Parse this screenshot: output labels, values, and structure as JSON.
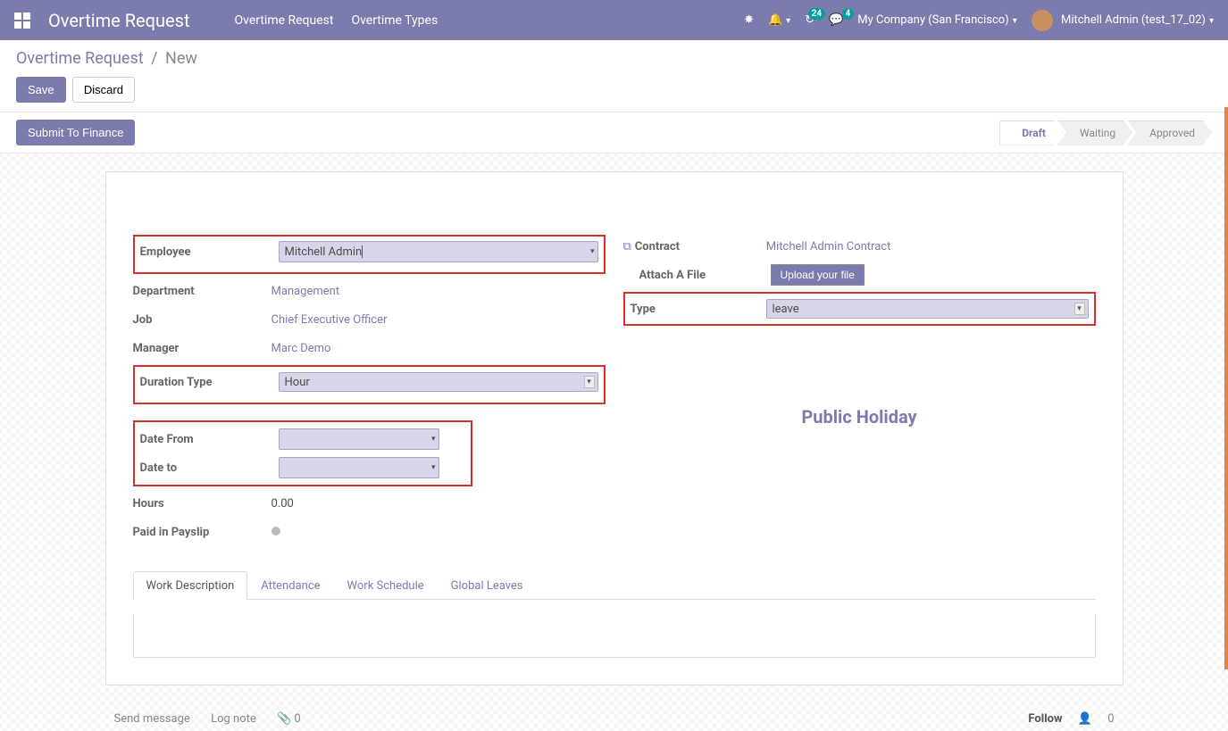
{
  "navbar": {
    "brand": "Overtime Request",
    "links": [
      "Overtime Request",
      "Overtime Types"
    ],
    "activity_count": "24",
    "chat_count": "4",
    "company": "My Company (San Francisco)",
    "user": "Mitchell Admin (test_17_02)"
  },
  "breadcrumb": {
    "root": "Overtime Request",
    "current": "New"
  },
  "actions": {
    "save": "Save",
    "discard": "Discard",
    "submit": "Submit To Finance"
  },
  "stages": {
    "draft": "Draft",
    "waiting": "Waiting",
    "approved": "Approved"
  },
  "form": {
    "employee_label": "Employee",
    "employee_value": "Mitchell Admin",
    "department_label": "Department",
    "department_value": "Management",
    "job_label": "Job",
    "job_value": "Chief Executive Officer",
    "manager_label": "Manager",
    "manager_value": "Marc Demo",
    "duration_type_label": "Duration Type",
    "duration_type_value": "Hour",
    "date_from_label": "Date From",
    "date_from_value": "",
    "date_to_label": "Date to",
    "date_to_value": "",
    "hours_label": "Hours",
    "hours_value": "0.00",
    "paid_label": "Paid in Payslip",
    "contract_label": "Contract",
    "contract_value": "Mitchell Admin Contract",
    "attach_label": "Attach A File",
    "upload_button": "Upload your file",
    "type_label": "Type",
    "type_value": "leave",
    "public_holiday": "Public Holiday"
  },
  "tabs": {
    "work_description": "Work Description",
    "attendance": "Attendance",
    "work_schedule": "Work Schedule",
    "global_leaves": "Global Leaves"
  },
  "footer": {
    "send_message": "Send message",
    "log_note": "Log note",
    "attach_count": "0",
    "follow": "Follow",
    "follower_count": "0"
  }
}
